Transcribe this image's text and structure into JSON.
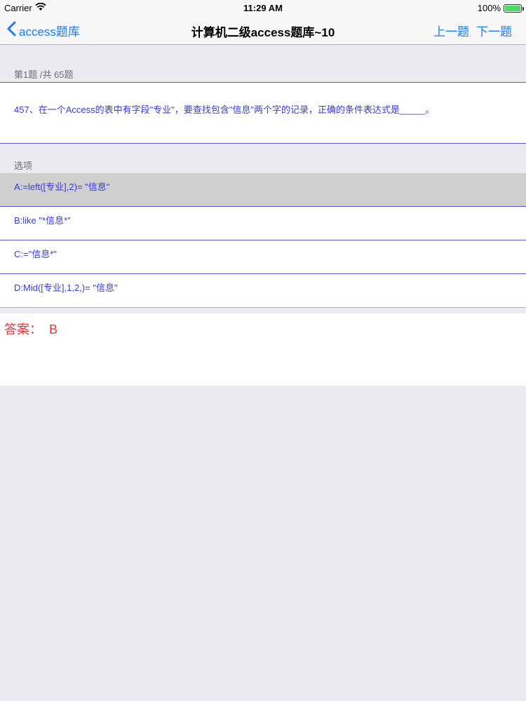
{
  "status_bar": {
    "carrier": "Carrier",
    "time": "11:29 AM",
    "battery": "100%"
  },
  "nav": {
    "back_label": "access题库",
    "title": "计算机二级access题库~10",
    "prev_label": "上一题",
    "next_label": "下一题"
  },
  "question": {
    "progress": "第1题 /共 65题",
    "text": "457、在一个Access的表中有字段\"专业\"，要查找包含\"信息\"两个字的记录，正确的条件表达式是_____。"
  },
  "options_header": "选项",
  "options": [
    {
      "label": "A:=left([专业],2)= \"信息\"",
      "selected": true
    },
    {
      "label": "B:like \"*信息*\"",
      "selected": false
    },
    {
      "label": "C:=\"信息*\"",
      "selected": false
    },
    {
      "label": "D:Mid([专业],1,2,)= \"信息\"",
      "selected": false
    }
  ],
  "answer": "答案：  B",
  "colors": {
    "accent": "#1a7bf2",
    "text_blue": "#3a3ad0",
    "answer_red": "#e0383e",
    "battery_green": "#4cd964"
  },
  "icons": [
    "wifi-icon",
    "battery-icon",
    "back-chevron-icon"
  ]
}
